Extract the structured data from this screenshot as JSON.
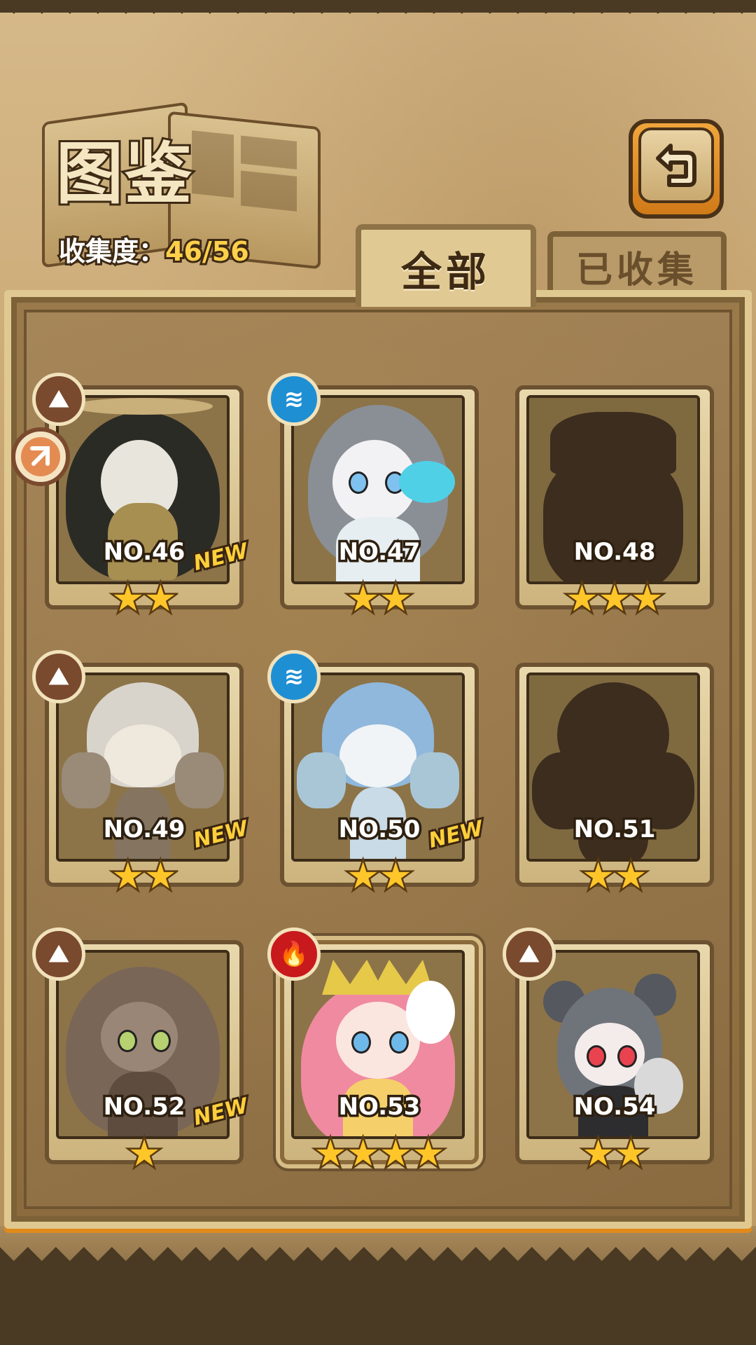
{
  "header": {
    "title": "图鉴",
    "progress_label": "收集度：",
    "progress_value": "46/56"
  },
  "tabs": [
    {
      "label": "全部",
      "selected": true
    },
    {
      "label": "已收集",
      "selected": false
    }
  ],
  "icons": {
    "back": "back-arrow-icon",
    "element_earth": "mountain-icon",
    "element_water": "wave-icon",
    "element_fire": "flame-icon",
    "side_tag": "arrow-badge-icon"
  },
  "colors": {
    "accent": "#e08a1c",
    "star": "#ffc62a",
    "water": "#1f8fd4",
    "fire": "#c8191d",
    "earth": "#7a4a2e"
  },
  "cards": [
    {
      "number": "NO.46",
      "stars": "★★",
      "new_label": "NEW",
      "element": "earth",
      "locked": false
    },
    {
      "number": "NO.47",
      "stars": "★★",
      "new_label": "",
      "element": "water",
      "locked": false
    },
    {
      "number": "NO.48",
      "stars": "★★★",
      "new_label": "",
      "element": "",
      "locked": true
    },
    {
      "number": "NO.49",
      "stars": "★★",
      "new_label": "NEW",
      "element": "earth",
      "locked": false
    },
    {
      "number": "NO.50",
      "stars": "★★",
      "new_label": "NEW",
      "element": "water",
      "locked": false
    },
    {
      "number": "NO.51",
      "stars": "★★",
      "new_label": "",
      "element": "",
      "locked": true
    },
    {
      "number": "NO.52",
      "stars": "★",
      "new_label": "NEW",
      "element": "earth",
      "locked": false
    },
    {
      "number": "NO.53",
      "stars": "★★★★",
      "new_label": "",
      "element": "fire",
      "locked": false
    },
    {
      "number": "NO.54",
      "stars": "★★",
      "new_label": "",
      "element": "earth",
      "locked": false
    }
  ]
}
